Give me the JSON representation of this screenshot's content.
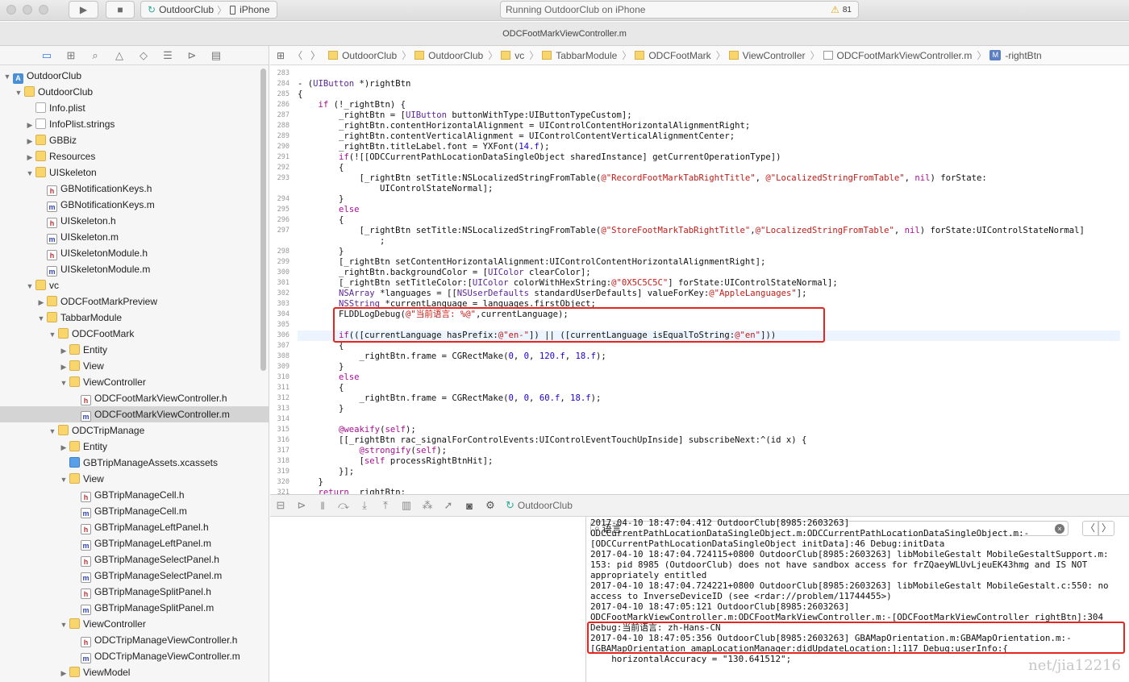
{
  "toolbar": {
    "scheme": "OutdoorClub",
    "device": "iPhone",
    "activity": "Running OutdoorClub on iPhone",
    "warning_count": "81"
  },
  "tab_title": "ODCFootMarkViewController.m",
  "navigator": {
    "rows": [
      {
        "label": "OutdoorClub",
        "depth": 0,
        "icon": "proj",
        "disc": "▼"
      },
      {
        "label": "OutdoorClub",
        "depth": 1,
        "icon": "folder",
        "disc": "▼"
      },
      {
        "label": "Info.plist",
        "depth": 2,
        "icon": "plist",
        "disc": ""
      },
      {
        "label": "InfoPlist.strings",
        "depth": 2,
        "icon": "strings",
        "disc": "▶"
      },
      {
        "label": "GBBiz",
        "depth": 2,
        "icon": "folder",
        "disc": "▶"
      },
      {
        "label": "Resources",
        "depth": 2,
        "icon": "folder",
        "disc": "▶"
      },
      {
        "label": "UISkeleton",
        "depth": 2,
        "icon": "folder",
        "disc": "▼"
      },
      {
        "label": "GBNotificationKeys.h",
        "depth": 3,
        "icon": "h",
        "disc": ""
      },
      {
        "label": "GBNotificationKeys.m",
        "depth": 3,
        "icon": "m",
        "disc": ""
      },
      {
        "label": "UISkeleton.h",
        "depth": 3,
        "icon": "h",
        "disc": ""
      },
      {
        "label": "UISkeleton.m",
        "depth": 3,
        "icon": "m",
        "disc": ""
      },
      {
        "label": "UISkeletonModule.h",
        "depth": 3,
        "icon": "h",
        "disc": ""
      },
      {
        "label": "UISkeletonModule.m",
        "depth": 3,
        "icon": "m",
        "disc": ""
      },
      {
        "label": "vc",
        "depth": 2,
        "icon": "folder",
        "disc": "▼"
      },
      {
        "label": "ODCFootMarkPreview",
        "depth": 3,
        "icon": "folder",
        "disc": "▶"
      },
      {
        "label": "TabbarModule",
        "depth": 3,
        "icon": "folder",
        "disc": "▼"
      },
      {
        "label": "ODCFootMark",
        "depth": 4,
        "icon": "folder",
        "disc": "▼"
      },
      {
        "label": "Entity",
        "depth": 5,
        "icon": "folder",
        "disc": "▶"
      },
      {
        "label": "View",
        "depth": 5,
        "icon": "folder",
        "disc": "▶"
      },
      {
        "label": "ViewController",
        "depth": 5,
        "icon": "folder",
        "disc": "▼"
      },
      {
        "label": "ODCFootMarkViewController.h",
        "depth": 6,
        "icon": "h",
        "disc": ""
      },
      {
        "label": "ODCFootMarkViewController.m",
        "depth": 6,
        "icon": "m",
        "disc": "",
        "selected": true
      },
      {
        "label": "ODCTripManage",
        "depth": 4,
        "icon": "folder",
        "disc": "▼"
      },
      {
        "label": "Entity",
        "depth": 5,
        "icon": "folder",
        "disc": "▶"
      },
      {
        "label": "GBTripManageAssets.xcassets",
        "depth": 5,
        "icon": "assets",
        "disc": ""
      },
      {
        "label": "View",
        "depth": 5,
        "icon": "folder",
        "disc": "▼"
      },
      {
        "label": "GBTripManageCell.h",
        "depth": 6,
        "icon": "h",
        "disc": ""
      },
      {
        "label": "GBTripManageCell.m",
        "depth": 6,
        "icon": "m",
        "disc": ""
      },
      {
        "label": "GBTripManageLeftPanel.h",
        "depth": 6,
        "icon": "h",
        "disc": ""
      },
      {
        "label": "GBTripManageLeftPanel.m",
        "depth": 6,
        "icon": "m",
        "disc": ""
      },
      {
        "label": "GBTripManageSelectPanel.h",
        "depth": 6,
        "icon": "h",
        "disc": ""
      },
      {
        "label": "GBTripManageSelectPanel.m",
        "depth": 6,
        "icon": "m",
        "disc": ""
      },
      {
        "label": "GBTripManageSplitPanel.h",
        "depth": 6,
        "icon": "h",
        "disc": ""
      },
      {
        "label": "GBTripManageSplitPanel.m",
        "depth": 6,
        "icon": "m",
        "disc": ""
      },
      {
        "label": "ViewController",
        "depth": 5,
        "icon": "folder",
        "disc": "▼"
      },
      {
        "label": "ODCTripManageViewController.h",
        "depth": 6,
        "icon": "h",
        "disc": ""
      },
      {
        "label": "ODCTripManageViewController.m",
        "depth": 6,
        "icon": "m",
        "disc": ""
      },
      {
        "label": "ViewModel",
        "depth": 5,
        "icon": "folder",
        "disc": "▶"
      }
    ]
  },
  "jumpbar": {
    "items": [
      "OutdoorClub",
      "OutdoorClub",
      "vc",
      "TabbarModule",
      "ODCFootMark",
      "ViewController",
      "ODCFootMarkViewController.m",
      "-rightBtn"
    ],
    "method_badge": "M"
  },
  "code": {
    "lines": [
      {
        "n": "283",
        "t": ""
      },
      {
        "n": "284",
        "t": "- (UIButton *)rightBtn"
      },
      {
        "n": "285",
        "t": "{"
      },
      {
        "n": "286",
        "t": "    if (!_rightBtn) {"
      },
      {
        "n": "287",
        "t": "        _rightBtn = [UIButton buttonWithType:UIButtonTypeCustom];"
      },
      {
        "n": "288",
        "t": "        _rightBtn.contentHorizontalAlignment = UIControlContentHorizontalAlignmentRight;"
      },
      {
        "n": "289",
        "t": "        _rightBtn.contentVerticalAlignment = UIControlContentVerticalAlignmentCenter;"
      },
      {
        "n": "290",
        "t": "        _rightBtn.titleLabel.font = YXFont(14.f);"
      },
      {
        "n": "291",
        "t": "        if(![[ODCCurrentPathLocationDataSingleObject sharedInstance] getCurrentOperationType])"
      },
      {
        "n": "292",
        "t": "        {"
      },
      {
        "n": "293",
        "t": "            [_rightBtn setTitle:NSLocalizedStringFromTable(@\"RecordFootMarkTabRightTitle\", @\"LocalizedStringFromTable\", nil) forState:"
      },
      {
        "n": "",
        "t": "                UIControlStateNormal];"
      },
      {
        "n": "294",
        "t": "        }"
      },
      {
        "n": "295",
        "t": "        else"
      },
      {
        "n": "296",
        "t": "        {"
      },
      {
        "n": "297",
        "t": "            [_rightBtn setTitle:NSLocalizedStringFromTable(@\"StoreFootMarkTabRightTitle\",@\"LocalizedStringFromTable\", nil) forState:UIControlStateNormal]"
      },
      {
        "n": "",
        "t": "                ;"
      },
      {
        "n": "298",
        "t": "        }"
      },
      {
        "n": "299",
        "t": "        [_rightBtn setContentHorizontalAlignment:UIControlContentHorizontalAlignmentRight];"
      },
      {
        "n": "300",
        "t": "        _rightBtn.backgroundColor = [UIColor clearColor];"
      },
      {
        "n": "301",
        "t": "        [_rightBtn setTitleColor:[UIColor colorWithHexString:@\"0X5C5C5C\"] forState:UIControlStateNormal];"
      },
      {
        "n": "302",
        "t": "        NSArray *languages = [[NSUserDefaults standardUserDefaults] valueForKey:@\"AppleLanguages\"];"
      },
      {
        "n": "303",
        "t": "        NSString *currentLanguage = languages.firstObject;"
      },
      {
        "n": "304",
        "t": "        FLDDLogDebug(@\"当前语言: %@\",currentLanguage);"
      },
      {
        "n": "305",
        "t": ""
      },
      {
        "n": "306",
        "t": "        if(([currentLanguage hasPrefix:@\"en-\"]) || ([currentLanguage isEqualToString:@\"en\"]))"
      },
      {
        "n": "307",
        "t": "        {"
      },
      {
        "n": "308",
        "t": "            _rightBtn.frame = CGRectMake(0, 0, 120.f, 18.f);"
      },
      {
        "n": "309",
        "t": "        }"
      },
      {
        "n": "310",
        "t": "        else"
      },
      {
        "n": "311",
        "t": "        {"
      },
      {
        "n": "312",
        "t": "            _rightBtn.frame = CGRectMake(0, 0, 60.f, 18.f);"
      },
      {
        "n": "313",
        "t": "        }"
      },
      {
        "n": "314",
        "t": ""
      },
      {
        "n": "315",
        "t": "        @weakify(self);"
      },
      {
        "n": "316",
        "t": "        [[_rightBtn rac_signalForControlEvents:UIControlEventTouchUpInside] subscribeNext:^(id x) {"
      },
      {
        "n": "317",
        "t": "            @strongify(self);"
      },
      {
        "n": "318",
        "t": "            [self processRightBtnHit];"
      },
      {
        "n": "319",
        "t": "        }];"
      },
      {
        "n": "320",
        "t": "    }"
      },
      {
        "n": "321",
        "t": "    return _rightBtn;"
      }
    ]
  },
  "debug": {
    "target": "OutdoorClub"
  },
  "console": {
    "filter_text": "语言",
    "lines": [
      "2017-04-10 18:47:04.412 OutdoorClub[8985:2603263]",
      "ODCCurrentPathLocationDataSingleObject.m:ODCCurrentPathLocationDataSingleObject.m:-",
      "[ODCCurrentPathLocationDataSingleObject initData]:46 Debug:initData",
      "2017-04-10 18:47:04.724115+0800 OutdoorClub[8985:2603263] libMobileGestalt MobileGestaltSupport.m:",
      "153: pid 8985 (OutdoorClub) does not have sandbox access for frZQaeyWLUvLjeuEK43hmg and IS NOT",
      "appropriately entitled",
      "2017-04-10 18:47:04.724221+0800 OutdoorClub[8985:2603263] libMobileGestalt MobileGestalt.c:550: no",
      "access to InverseDeviceID (see <rdar://problem/11744455>)",
      "2017-04-10 18:47:05:121 OutdoorClub[8985:2603263]",
      "ODCFootMarkViewController.m:ODCFootMarkViewController.m:-[ODCFootMarkViewController rightBtn]:304",
      "Debug:当前语言: zh-Hans-CN",
      "2017-04-10 18:47:05:356 OutdoorClub[8985:2603263] GBAMapOrientation.m:GBAMapOrientation.m:-",
      "[GBAMapOrientation amapLocationManager:didUpdateLocation:]:117 Debug:userInfo:{",
      "    horizontalAccuracy = \"130.641512\";"
    ]
  },
  "watermark": "net/jia12216"
}
